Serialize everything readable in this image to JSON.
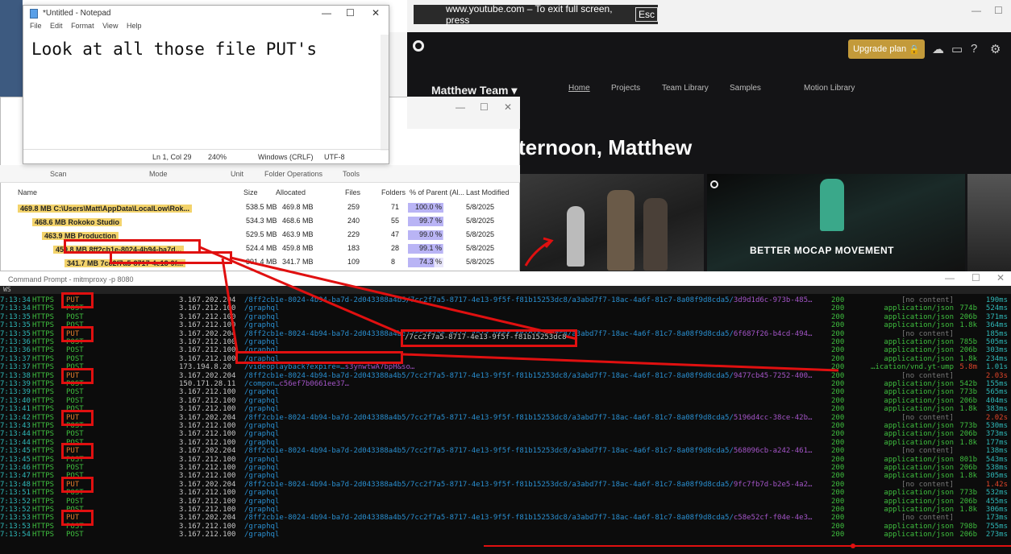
{
  "youtube_banner": {
    "text": "www.youtube.com – To exit full screen, press",
    "key": "Esc"
  },
  "webapp": {
    "upgrade_label": "Upgrade plan",
    "team_name": "Matthew Team",
    "nav": [
      "Home",
      "Projects",
      "Team Library",
      "Samples",
      "Motion Library"
    ],
    "greeting": "ternoon, Matthew",
    "card_title": "BETTER MOCAP MOVEMENT"
  },
  "notepad": {
    "title": "*Untitled - Notepad",
    "menu": [
      "File",
      "Edit",
      "Format",
      "View",
      "Help"
    ],
    "text": "Look at all those file PUT's",
    "status": {
      "position": "Ln 1, Col 29",
      "zoom": "240%",
      "line_endings": "Windows (CRLF)",
      "encoding": "UTF-8"
    }
  },
  "windirstat": {
    "ribbon": [
      "Scan",
      "Mode",
      "Unit",
      "Folder Operations",
      "Tools"
    ],
    "columns": [
      "Name",
      "Size",
      "Allocated",
      "Files",
      "Folders",
      "% of Parent (Al...",
      "Last Modified"
    ],
    "rows": [
      {
        "name": "469.8 MB  C:\\Users\\Matt\\AppData\\LocalLow\\Rok...",
        "size": "538.5 MB",
        "allocated": "469.8 MB",
        "files": "259",
        "folders": "71",
        "pct": "100.0 %",
        "modified": "5/8/2025"
      },
      {
        "name": "468.6 MB  Rokoko Studio",
        "size": "534.3 MB",
        "allocated": "468.6 MB",
        "files": "240",
        "folders": "55",
        "pct": "99.7 %",
        "modified": "5/8/2025"
      },
      {
        "name": "463.9 MB  Production",
        "size": "529.5 MB",
        "allocated": "463.9 MB",
        "files": "229",
        "folders": "47",
        "pct": "99.0 %",
        "modified": "5/8/2025"
      },
      {
        "name": "459.8 MB  8ff2cb1e-8024-4b94-ba7d...",
        "size": "524.4 MB",
        "allocated": "459.8 MB",
        "files": "183",
        "folders": "28",
        "pct": "99.1 %",
        "modified": "5/8/2025"
      },
      {
        "name": "341.7 MB  7cc2f7a5-8717-4e13-9f...",
        "size": "391.4 MB",
        "allocated": "341.7 MB",
        "files": "109",
        "folders": "8",
        "pct": "74.3 %",
        "modified": "5/8/2025"
      }
    ]
  },
  "cmd": {
    "title": "Command Prompt - mitmproxy -p 8080",
    "header": "WS",
    "rows": [
      {
        "time": "7:13:34",
        "proto": "HTTPS",
        "method": "PUT",
        "host": "3.167.202.204",
        "path": "/8ff2cb1e-8024-4b94-ba7d-2d043388a4b5/7cc2f7a5-8717-4e13-9f5f-f81b15253dc8/a3abd7f7-18ac-4a6f-81c7-8a08f9d8cda5/",
        "tail": "3d9d1d6c-973b-485…",
        "code": "200",
        "ctype": "[no content]",
        "size": "",
        "dur": "190ms"
      },
      {
        "time": "7:13:34",
        "proto": "HTTPS",
        "method": "POST",
        "host": "3.167.212.100",
        "path": "/graphql",
        "tail": "",
        "code": "200",
        "ctype": "application/json",
        "size": "774b",
        "dur": "524ms"
      },
      {
        "time": "7:13:35",
        "proto": "HTTPS",
        "method": "POST",
        "host": "3.167.212.100",
        "path": "/graphql",
        "tail": "",
        "code": "200",
        "ctype": "application/json",
        "size": "206b",
        "dur": "371ms"
      },
      {
        "time": "7:13:35",
        "proto": "HTTPS",
        "method": "POST",
        "host": "3.167.212.100",
        "path": "/graphql",
        "tail": "",
        "code": "200",
        "ctype": "application/json",
        "size": "1.8k",
        "dur": "364ms"
      },
      {
        "time": "7:13:35",
        "proto": "HTTPS",
        "method": "PUT",
        "host": "3.167.202.204",
        "path": "/8ff2cb1e-8024-4b94-ba7d-2d043388a4b5/7cc2f7a5-8717-4e13-9f5f-f81b15253dc8/a3abd7f7-18ac-4a6f-81c7-8a08f9d8cda5/",
        "tail": "6f687f26-b4cd-494…",
        "code": "200",
        "ctype": "[no content]",
        "size": "",
        "dur": "185ms"
      },
      {
        "time": "7:13:36",
        "proto": "HTTPS",
        "method": "POST",
        "host": "3.167.212.100",
        "path": "/graphql",
        "tail": "",
        "code": "200",
        "ctype": "application/json",
        "size": "785b",
        "dur": "505ms"
      },
      {
        "time": "7:13:36",
        "proto": "HTTPS",
        "method": "POST",
        "host": "3.167.212.100",
        "path": "/graphql",
        "tail": "",
        "code": "200",
        "ctype": "application/json",
        "size": "206b",
        "dur": "303ms"
      },
      {
        "time": "7:13:37",
        "proto": "HTTPS",
        "method": "POST",
        "host": "3.167.212.100",
        "path": "/graphql",
        "tail": "",
        "code": "200",
        "ctype": "application/json",
        "size": "1.8k",
        "dur": "234ms"
      },
      {
        "time": "7:13:37",
        "proto": "HTTPS",
        "method": "POST",
        "host": "173.194.8.20",
        "path": "/videoplayback?expire=…",
        "tail": "s3ynwtwA7bpH&so…",
        "code": "200",
        "ctype": "…ication/vnd.yt-ump",
        "size": "5.8m",
        "dur": "1.01s"
      },
      {
        "time": "7:13:38",
        "proto": "HTTPS",
        "method": "PUT",
        "host": "3.167.202.204",
        "path": "/8ff2cb1e-8024-4b94-ba7d-2d043388a4b5/7cc2f7a5-8717-4e13-9f5f-f81b15253dc8/a3abd7f7-18ac-4a6f-81c7-8a08f9d8cda5/",
        "tail": "9477cb45-7252-400…",
        "code": "200",
        "ctype": "[no content]",
        "size": "",
        "dur": "2.03s"
      },
      {
        "time": "7:13:39",
        "proto": "HTTPS",
        "method": "POST",
        "host": "150.171.28.11",
        "path": "/compon…",
        "tail": "c56ef7b0661ee37…",
        "code": "200",
        "ctype": "application/json",
        "size": "542b",
        "dur": "155ms"
      },
      {
        "time": "7:13:39",
        "proto": "HTTPS",
        "method": "POST",
        "host": "3.167.212.100",
        "path": "/graphql",
        "tail": "",
        "code": "200",
        "ctype": "application/json",
        "size": "773b",
        "dur": "565ms"
      },
      {
        "time": "7:13:40",
        "proto": "HTTPS",
        "method": "POST",
        "host": "3.167.212.100",
        "path": "/graphql",
        "tail": "",
        "code": "200",
        "ctype": "application/json",
        "size": "206b",
        "dur": "404ms"
      },
      {
        "time": "7:13:41",
        "proto": "HTTPS",
        "method": "POST",
        "host": "3.167.212.100",
        "path": "/graphql",
        "tail": "",
        "code": "200",
        "ctype": "application/json",
        "size": "1.8k",
        "dur": "383ms"
      },
      {
        "time": "7:13:42",
        "proto": "HTTPS",
        "method": "PUT",
        "host": "3.167.202.204",
        "path": "/8ff2cb1e-8024-4b94-ba7d-2d043388a4b5/7cc2f7a5-8717-4e13-9f5f-f81b15253dc8/a3abd7f7-18ac-4a6f-81c7-8a08f9d8cda5/",
        "tail": "5196d4cc-38ce-42b…",
        "code": "200",
        "ctype": "[no content]",
        "size": "",
        "dur": "2.02s"
      },
      {
        "time": "7:13:43",
        "proto": "HTTPS",
        "method": "POST",
        "host": "3.167.212.100",
        "path": "/graphql",
        "tail": "",
        "code": "200",
        "ctype": "application/json",
        "size": "773b",
        "dur": "530ms"
      },
      {
        "time": "7:13:44",
        "proto": "HTTPS",
        "method": "POST",
        "host": "3.167.212.100",
        "path": "/graphql",
        "tail": "",
        "code": "200",
        "ctype": "application/json",
        "size": "206b",
        "dur": "373ms"
      },
      {
        "time": "7:13:44",
        "proto": "HTTPS",
        "method": "POST",
        "host": "3.167.212.100",
        "path": "/graphql",
        "tail": "",
        "code": "200",
        "ctype": "application/json",
        "size": "1.8k",
        "dur": "177ms"
      },
      {
        "time": "7:13:45",
        "proto": "HTTPS",
        "method": "PUT",
        "host": "3.167.202.204",
        "path": "/8ff2cb1e-8024-4b94-ba7d-2d043388a4b5/7cc2f7a5-8717-4e13-9f5f-f81b15253dc8/a3abd7f7-18ac-4a6f-81c7-8a08f9d8cda5/",
        "tail": "568096cb-a242-461…",
        "code": "200",
        "ctype": "[no content]",
        "size": "",
        "dur": "138ms"
      },
      {
        "time": "7:13:45",
        "proto": "HTTPS",
        "method": "POST",
        "host": "3.167.212.100",
        "path": "/graphql",
        "tail": "",
        "code": "200",
        "ctype": "application/json",
        "size": "801b",
        "dur": "543ms"
      },
      {
        "time": "7:13:46",
        "proto": "HTTPS",
        "method": "POST",
        "host": "3.167.212.100",
        "path": "/graphql",
        "tail": "",
        "code": "200",
        "ctype": "application/json",
        "size": "206b",
        "dur": "538ms"
      },
      {
        "time": "7:13:47",
        "proto": "HTTPS",
        "method": "POST",
        "host": "3.167.212.100",
        "path": "/graphql",
        "tail": "",
        "code": "200",
        "ctype": "application/json",
        "size": "1.8k",
        "dur": "305ms"
      },
      {
        "time": "7:13:48",
        "proto": "HTTPS",
        "method": "PUT",
        "host": "3.167.202.204",
        "path": "/8ff2cb1e-8024-4b94-ba7d-2d043388a4b5/7cc2f7a5-8717-4e13-9f5f-f81b15253dc8/a3abd7f7-18ac-4a6f-81c7-8a08f9d8cda5/",
        "tail": "9fc7fb7d-b2e5-4a2…",
        "code": "200",
        "ctype": "[no content]",
        "size": "",
        "dur": "1.42s"
      },
      {
        "time": "7:13:51",
        "proto": "HTTPS",
        "method": "POST",
        "host": "3.167.212.100",
        "path": "/graphql",
        "tail": "",
        "code": "200",
        "ctype": "application/json",
        "size": "773b",
        "dur": "532ms"
      },
      {
        "time": "7:13:52",
        "proto": "HTTPS",
        "method": "POST",
        "host": "3.167.212.100",
        "path": "/graphql",
        "tail": "",
        "code": "200",
        "ctype": "application/json",
        "size": "206b",
        "dur": "455ms"
      },
      {
        "time": "7:13:52",
        "proto": "HTTPS",
        "method": "POST",
        "host": "3.167.212.100",
        "path": "/graphql",
        "tail": "",
        "code": "200",
        "ctype": "application/json",
        "size": "1.8k",
        "dur": "306ms"
      },
      {
        "time": "7:13:53",
        "proto": "HTTPS",
        "method": "PUT",
        "host": "3.167.202.204",
        "path": "/8ff2cb1e-8024-4b94-ba7d-2d043388a4b5/7cc2f7a5-8717-4e13-9f5f-f81b15253dc8/a3abd7f7-18ac-4a6f-81c7-8a08f9d8cda5/",
        "tail": "c58e52cf-f04e-4e3…",
        "code": "200",
        "ctype": "[no content]",
        "size": "",
        "dur": "173ms"
      },
      {
        "time": "7:13:53",
        "proto": "HTTPS",
        "method": "POST",
        "host": "3.167.212.100",
        "path": "/graphql",
        "tail": "",
        "code": "200",
        "ctype": "application/json",
        "size": "798b",
        "dur": "755ms"
      },
      {
        "time": "7:13:54",
        "proto": "HTTPS",
        "method": "POST",
        "host": "3.167.212.100",
        "path": "/graphql",
        "tail": "",
        "code": "200",
        "ctype": "application/json",
        "size": "206b",
        "dur": "273ms"
      }
    ]
  },
  "highlight_path": "/7cc2f7a5-8717-4e13-9f5f-f81b15253dc8",
  "colors": {
    "annotation": "#e01010",
    "put": "#e07a2a",
    "post": "#3fbf3f",
    "path": "#2a8fd0",
    "selection": "#f3d36b"
  }
}
